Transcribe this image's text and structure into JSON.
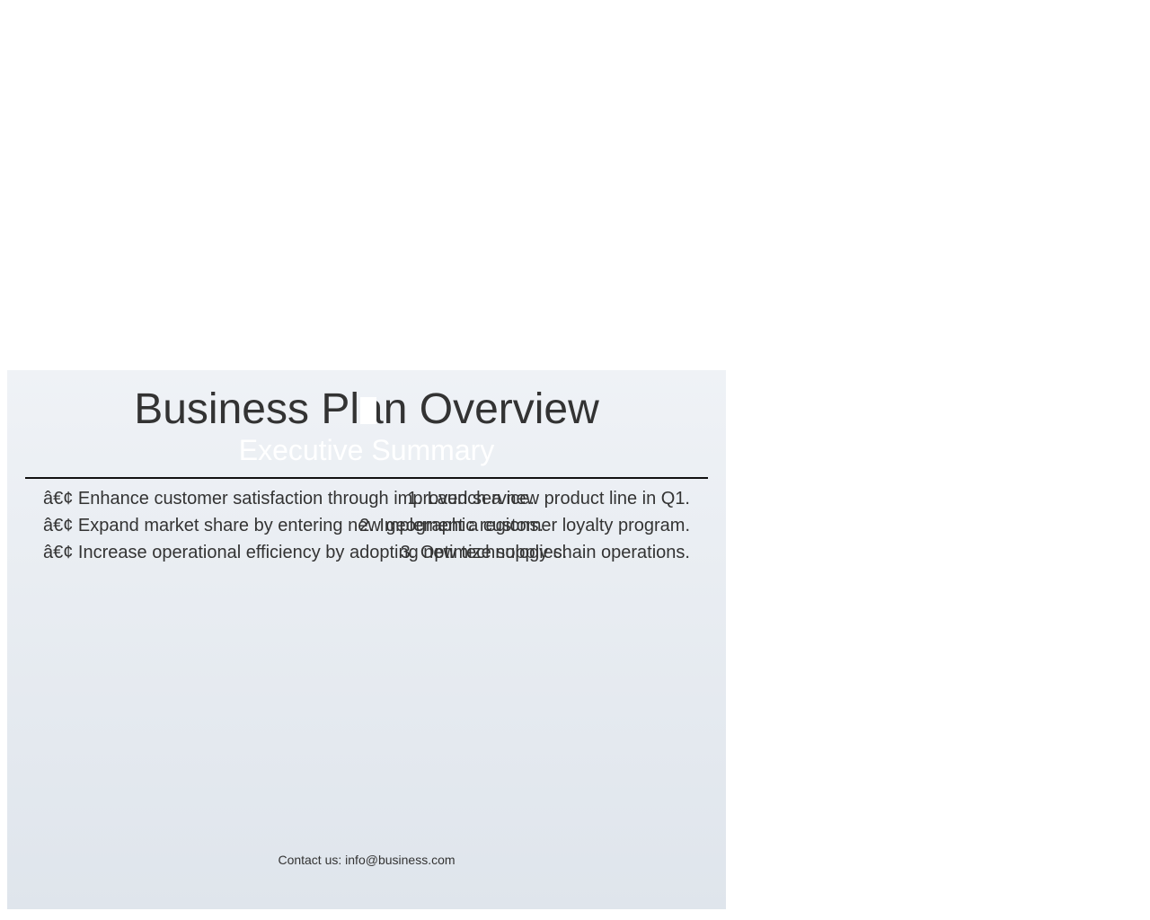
{
  "slide": {
    "title": "Business Plan Overview",
    "subtitle": "Executive Summary",
    "bullets": [
      "â€¢ Enhance customer satisfaction through improved service.",
      "â€¢ Expand market share by entering new geographic regions.",
      "â€¢ Increase operational efficiency by adopting new technologies."
    ],
    "numbered": [
      "1. Launch a new product line in Q1.",
      "2. Implement a customer loyalty program.",
      "3. Optimize supply chain operations."
    ],
    "footer": "Contact us: info@business.com"
  },
  "colors": {
    "background_top": "#eff2f6",
    "background_bottom": "#dfe5ec",
    "text": "#333333",
    "subtitle": "#ffffff",
    "rule": "#111111"
  }
}
